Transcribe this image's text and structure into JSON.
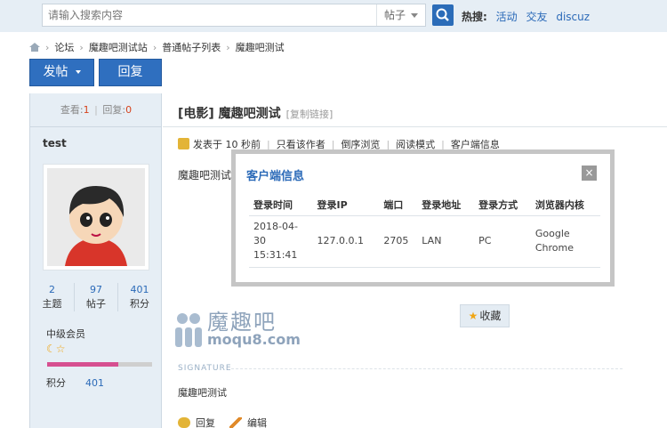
{
  "search": {
    "placeholder": "请输入搜索内容",
    "type": "帖子"
  },
  "hot": {
    "label": "热搜:",
    "links": [
      "活动",
      "交友",
      "discuz"
    ]
  },
  "breadcrumb": [
    "论坛",
    "魔趣吧测试站",
    "普通帖子列表",
    "魔趣吧测试"
  ],
  "buttons": {
    "post": "发帖",
    "reply": "回复"
  },
  "thread_stats": {
    "views_label": "查看:",
    "views": "1",
    "replies_label": "回复:",
    "replies": "0"
  },
  "author": {
    "name": "test",
    "counts": [
      {
        "value": "2",
        "label": "主题"
      },
      {
        "value": "97",
        "label": "帖子"
      },
      {
        "value": "401",
        "label": "积分"
      }
    ],
    "rank": "中级会员",
    "level_progress": 0.68,
    "points_label": "积分",
    "points": "401"
  },
  "thread": {
    "title": "[电影] 魔趣吧测试",
    "copy_link": "[复制链接]"
  },
  "meta": {
    "posted": "发表于 10 秒前",
    "only_author": "只看该作者",
    "reverse": "倒序浏览",
    "read_mode": "阅读模式",
    "client_info": "客户端信息"
  },
  "post": {
    "body": "魔趣吧测试"
  },
  "watermark": {
    "cn": "魔趣吧",
    "en": "moqu8.com"
  },
  "favorite": {
    "label": "收藏"
  },
  "signature": {
    "label": "SIGNATURE",
    "text": "魔趣吧测试"
  },
  "actions": {
    "reply": "回复",
    "edit": "编辑"
  },
  "modal": {
    "title": "客户端信息",
    "close": "×",
    "headers": [
      "登录时间",
      "登录IP",
      "端口",
      "登录地址",
      "登录方式",
      "浏览器内核"
    ],
    "row": {
      "time_date": "2018-04-",
      "time_day": "30",
      "time_clock": "15:31:41",
      "ip": "127.0.0.1",
      "port": "2705",
      "address": "LAN",
      "method": "PC",
      "browser_1": "Google",
      "browser_2": "Chrome"
    }
  },
  "colors": {
    "accent": "#2f6fbf",
    "link": "#2b6ab8",
    "highlight": "#d6431d"
  }
}
